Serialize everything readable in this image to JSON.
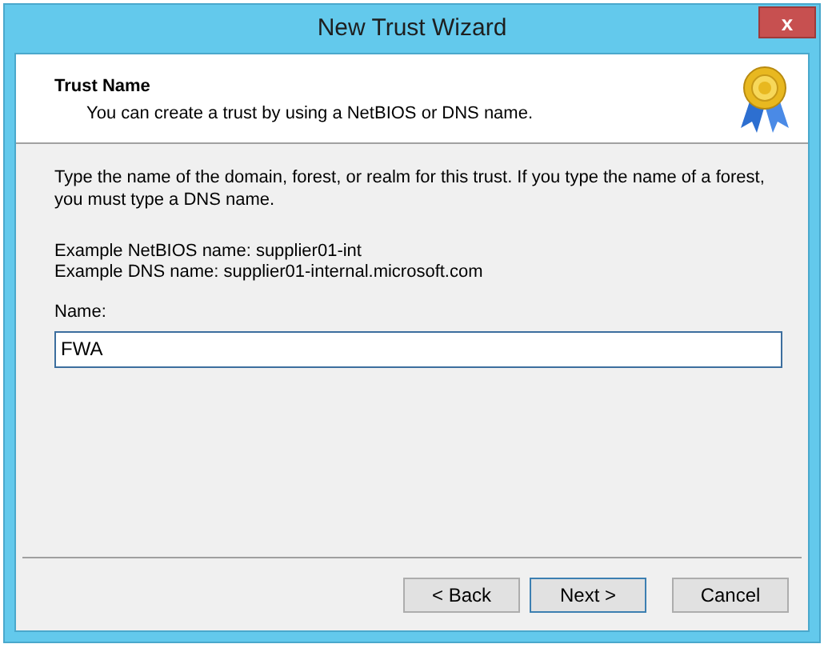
{
  "window": {
    "title": "New Trust Wizard",
    "close": "x"
  },
  "header": {
    "title": "Trust Name",
    "subtitle": "You can create a trust by using a NetBIOS or DNS name."
  },
  "instructions": "Type the name of the domain, forest, or realm for this trust. If you type the name of a forest, you must type a DNS name.",
  "examples": [
    "Example NetBIOS name: supplier01-int",
    "Example DNS name: supplier01-internal.microsoft.com"
  ],
  "name_field": {
    "label": "Name:",
    "value": "FWA"
  },
  "buttons": [
    {
      "label": "< Back",
      "default": false
    },
    {
      "label": "Next >",
      "default": true
    },
    {
      "label": "Cancel",
      "default": false
    }
  ]
}
